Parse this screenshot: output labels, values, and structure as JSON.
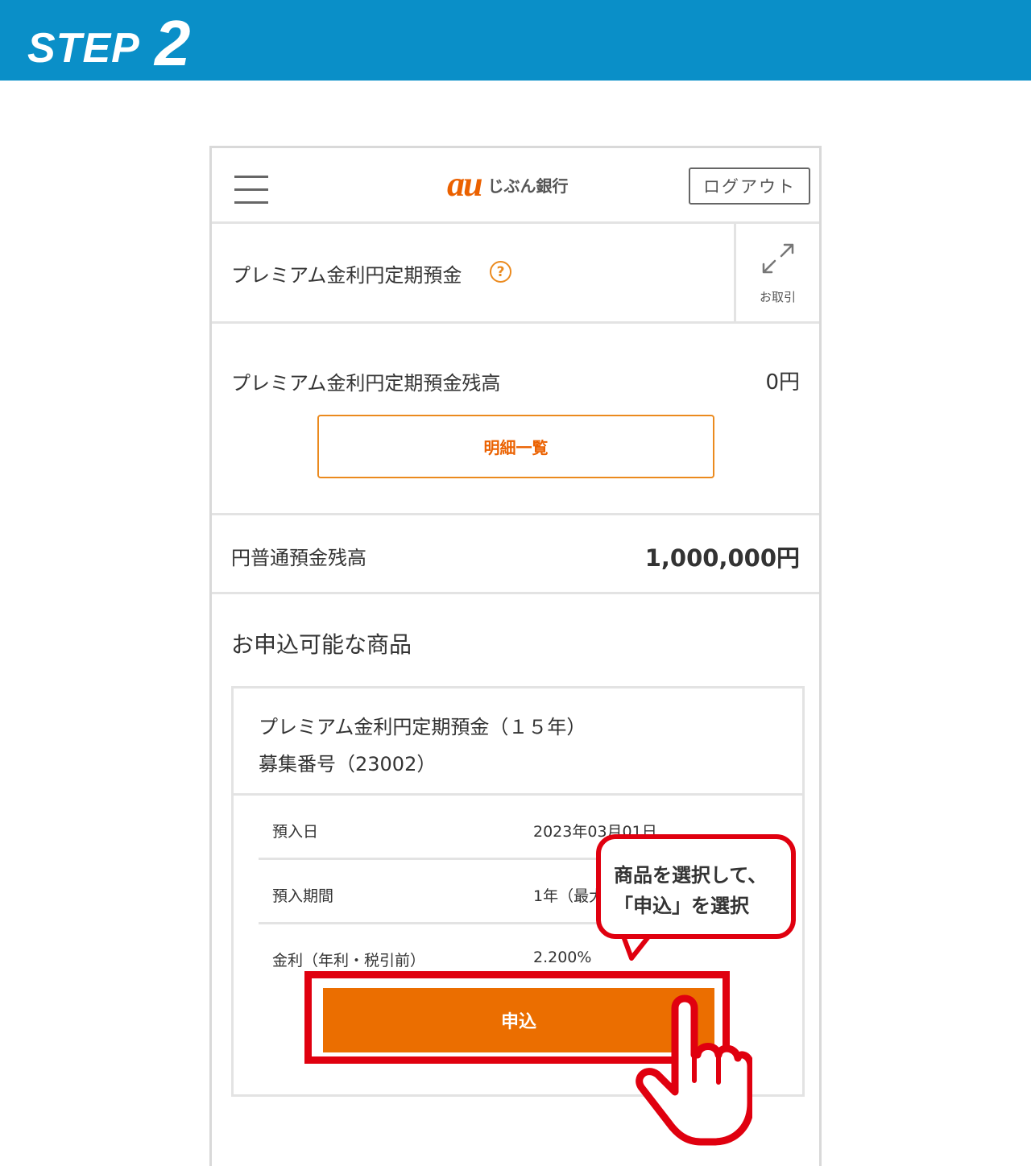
{
  "banner": {
    "step_label": "STEP",
    "step_number": "2",
    "color": "#0a8fc8"
  },
  "header": {
    "logo_au": "au",
    "logo_bank": "じぶん銀行",
    "logout_label": "ログアウト"
  },
  "product": {
    "title": "プレミアム金利円定期預金",
    "help_symbol": "?",
    "transaction_label": "お取引"
  },
  "balance": {
    "label": "プレミアム金利円定期預金残高",
    "value": "0円",
    "statement_button": "明細一覧"
  },
  "savings": {
    "label": "円普通預金残高",
    "value": "1,000,000円"
  },
  "available": {
    "title": "お申込可能な商品",
    "card": {
      "name": "プレミアム金利円定期預金（１５年）",
      "number": "募集番号（23002）",
      "details": [
        {
          "key": "預入日",
          "value": "2023年03月01日"
        },
        {
          "key": "預入期間",
          "value": "1年（最大"
        },
        {
          "key": "金利（年利・税引前）",
          "value": "2.200%"
        }
      ],
      "apply_button": "申込"
    }
  },
  "annotation": {
    "callout_line1": "商品を選択して、",
    "callout_line2": "「申込」を選択",
    "highlight_color": "#e0000f"
  },
  "colors": {
    "accent": "#eb6e00",
    "border": "#e3e3e3"
  }
}
